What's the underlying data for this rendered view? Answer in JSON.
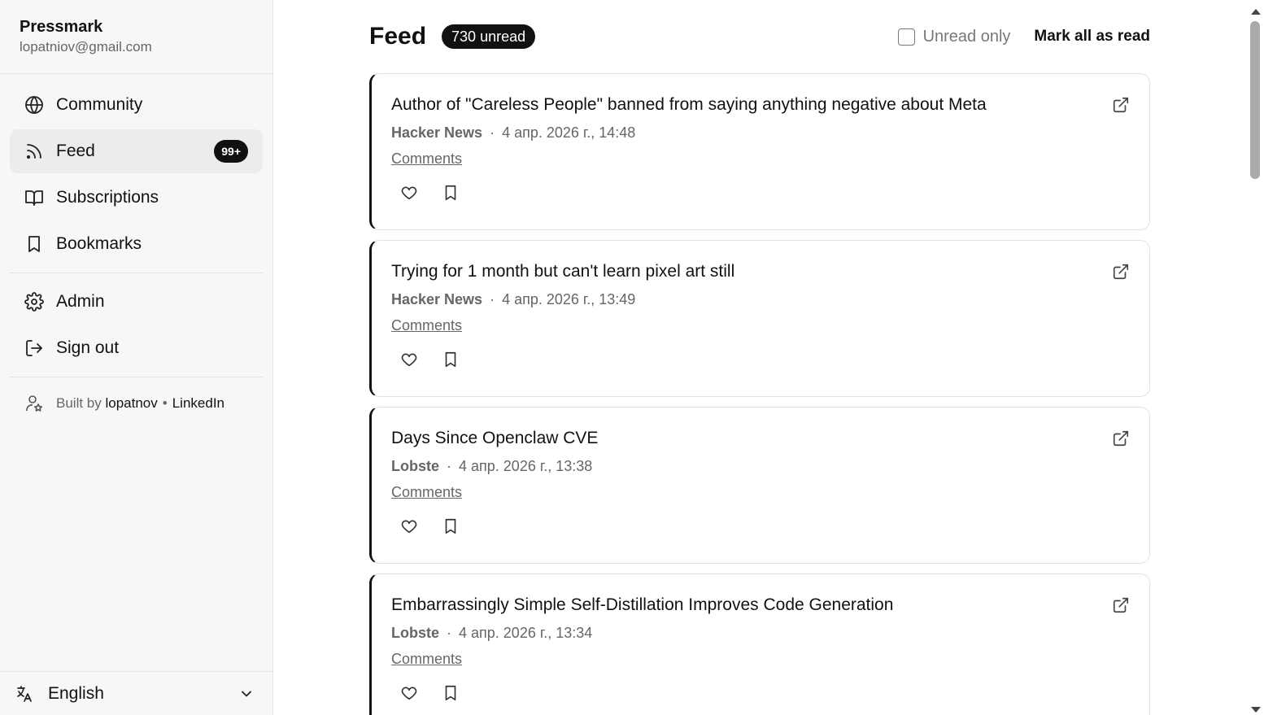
{
  "app": {
    "name": "Pressmark",
    "email": "lopatniov@gmail.com"
  },
  "nav": {
    "community": "Community",
    "feed": "Feed",
    "feed_badge": "99+",
    "subscriptions": "Subscriptions",
    "bookmarks": "Bookmarks",
    "admin": "Admin",
    "signout": "Sign out"
  },
  "built": {
    "prefix": "Built by",
    "author": "lopatnov",
    "dot": "•",
    "linkedin": "LinkedIn"
  },
  "language": {
    "selected": "English"
  },
  "feed": {
    "title": "Feed",
    "unread_badge": "730 unread",
    "unread_only_label": "Unread only",
    "mark_all_label": "Mark all as read"
  },
  "items": [
    {
      "title": "Author of \"Careless People\" banned from saying anything negative about Meta",
      "source": "Hacker News",
      "dot": "·",
      "date": "4 апр. 2026 г., 14:48",
      "comments": "Comments"
    },
    {
      "title": "Trying for 1 month but can't learn pixel art still",
      "source": "Hacker News",
      "dot": "·",
      "date": "4 апр. 2026 г., 13:49",
      "comments": "Comments"
    },
    {
      "title": "Days Since Openclaw CVE",
      "source": "Lobste",
      "dot": "·",
      "date": "4 апр. 2026 г., 13:38",
      "comments": "Comments"
    },
    {
      "title": "Embarrassingly Simple Self-Distillation Improves Code Generation",
      "source": "Lobste",
      "dot": "·",
      "date": "4 апр. 2026 г., 13:34",
      "comments": "Comments"
    }
  ],
  "icons": {
    "community": "globe-icon",
    "feed": "rss-icon",
    "subscriptions": "book-open-icon",
    "bookmarks": "bookmark-icon",
    "admin": "gear-icon",
    "signout": "sign-out-icon",
    "built": "user-star-icon",
    "language": "translate-icon",
    "external": "external-link-icon",
    "like": "heart-icon",
    "bookmark": "bookmark-icon"
  },
  "colors": {
    "accent": "#111111",
    "muted": "#666666",
    "sidebar_bg": "#f7f7f7",
    "border": "#e4e4e4"
  }
}
